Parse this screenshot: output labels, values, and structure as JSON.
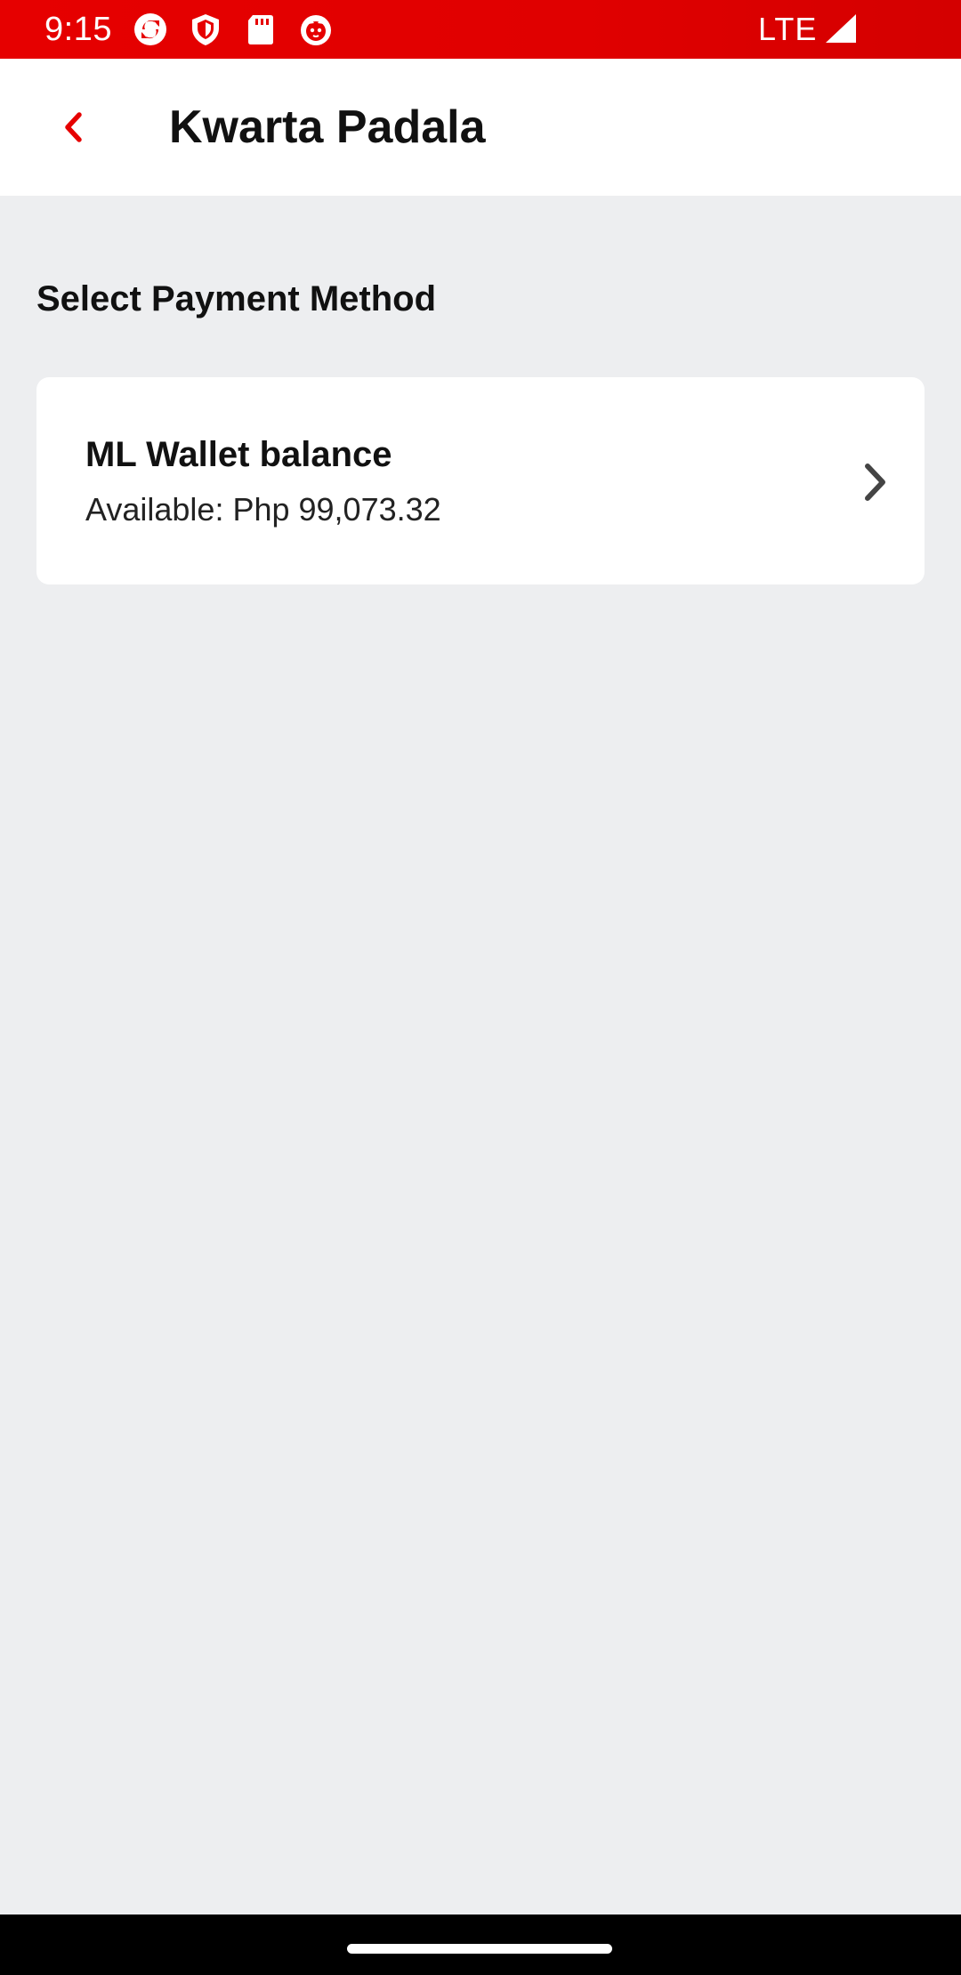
{
  "status_bar": {
    "time": "9:15",
    "network": "LTE",
    "icons": [
      "sync-app-icon",
      "shield-icon",
      "sd-card-icon",
      "cat-face-icon",
      "signal-icon"
    ],
    "background_color": "#e60000"
  },
  "header": {
    "back_icon": "chevron-left-icon",
    "title": "Kwarta Padala",
    "accent_color": "#e60000"
  },
  "main": {
    "section_title": "Select Payment Method",
    "payment_methods": [
      {
        "title": "ML Wallet balance",
        "subtitle": "Available: Php 99,073.32",
        "icon": "chevron-right-icon"
      }
    ]
  },
  "colors": {
    "background": "#edeef0",
    "card": "#ffffff",
    "nav_bar": "#000000"
  }
}
